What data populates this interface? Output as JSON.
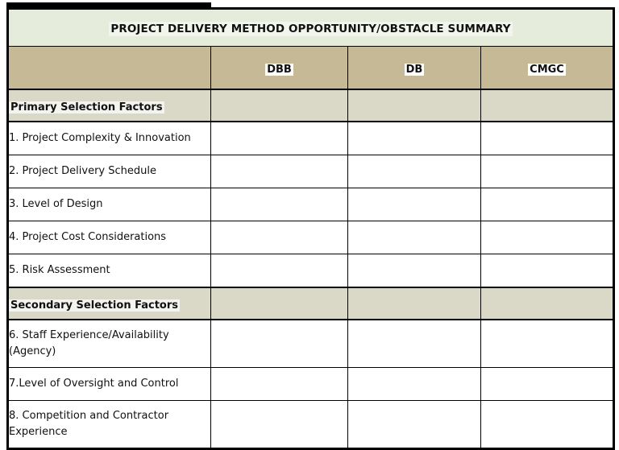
{
  "document": {
    "title": "PROJECT DELIVERY METHOD OPPORTUNITY/OBSTACLE SUMMARY"
  },
  "colors": {
    "title_band": "#e6ecdb",
    "header_band": "#c5ba95",
    "section_band": "#dad9c7",
    "cell": "#ffffff",
    "border": "#000000",
    "text": "#111111"
  },
  "table": {
    "columns": [
      {
        "key": "label",
        "label": ""
      },
      {
        "key": "dbb",
        "label": "DBB"
      },
      {
        "key": "db",
        "label": "DB"
      },
      {
        "key": "cmgc",
        "label": "CMGC"
      }
    ],
    "rows": [
      {
        "type": "section",
        "label": "Primary Selection Factors",
        "dbb": "",
        "db": "",
        "cmgc": ""
      },
      {
        "type": "factor",
        "label": "1. Project Complexity & Innovation",
        "dbb": "",
        "db": "",
        "cmgc": ""
      },
      {
        "type": "factor",
        "label": "2. Project Delivery Schedule",
        "dbb": "",
        "db": "",
        "cmgc": ""
      },
      {
        "type": "factor",
        "label": "3. Level of Design",
        "dbb": "",
        "db": "",
        "cmgc": ""
      },
      {
        "type": "factor",
        "label": "4. Project Cost Considerations",
        "dbb": "",
        "db": "",
        "cmgc": ""
      },
      {
        "type": "factor",
        "label": "5. Risk Assessment",
        "dbb": "",
        "db": "",
        "cmgc": ""
      },
      {
        "type": "section",
        "label": "Secondary Selection Factors",
        "dbb": "",
        "db": "",
        "cmgc": ""
      },
      {
        "type": "factor",
        "label": "6. Staff Experience/Availability (Agency)",
        "dbb": "",
        "db": "",
        "cmgc": ""
      },
      {
        "type": "factor",
        "label": "7.Level of Oversight and Control",
        "dbb": "",
        "db": "",
        "cmgc": ""
      },
      {
        "type": "factor",
        "label": "8. Competition and Contractor Experience",
        "dbb": "",
        "db": "",
        "cmgc": ""
      }
    ]
  }
}
